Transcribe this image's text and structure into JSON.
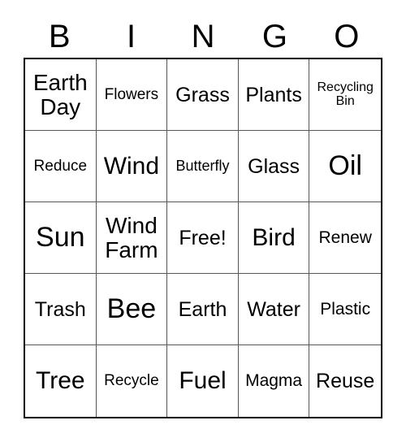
{
  "card": {
    "title": "Bingo Card",
    "header_letters": [
      "B",
      "I",
      "N",
      "G",
      "O"
    ],
    "columns": 5,
    "rows": 5,
    "free_space_label": "Free!",
    "colors": {
      "background": "#ffffff",
      "text": "#000000",
      "outer_border": "#000000",
      "grid_line": "#555555"
    },
    "cells": [
      {
        "text": "Earth\nDay",
        "size": "fs-lg"
      },
      {
        "text": "Flowers",
        "size": "fs-xs"
      },
      {
        "text": "Grass",
        "size": "fs-md"
      },
      {
        "text": "Plants",
        "size": "fs-md"
      },
      {
        "text": "Recycling\nBin",
        "size": "fs-tin"
      },
      {
        "text": "Reduce",
        "size": "fs-xs"
      },
      {
        "text": "Wind",
        "size": "fs-xl"
      },
      {
        "text": "Butterfly",
        "size": "fs-xxs"
      },
      {
        "text": "Glass",
        "size": "fs-md"
      },
      {
        "text": "Oil",
        "size": "fs-xxl"
      },
      {
        "text": "Sun",
        "size": "fs-xxl"
      },
      {
        "text": "Wind\nFarm",
        "size": "fs-lg"
      },
      {
        "text": "Free!",
        "size": "fs-md"
      },
      {
        "text": "Bird",
        "size": "fs-xl"
      },
      {
        "text": "Renew",
        "size": "fs-sm"
      },
      {
        "text": "Trash",
        "size": "fs-md"
      },
      {
        "text": "Bee",
        "size": "fs-xxl"
      },
      {
        "text": "Earth",
        "size": "fs-md"
      },
      {
        "text": "Water",
        "size": "fs-md"
      },
      {
        "text": "Plastic",
        "size": "fs-sm"
      },
      {
        "text": "Tree",
        "size": "fs-xl"
      },
      {
        "text": "Recycle",
        "size": "fs-xs"
      },
      {
        "text": "Fuel",
        "size": "fs-xl"
      },
      {
        "text": "Magma",
        "size": "fs-sm"
      },
      {
        "text": "Reuse",
        "size": "fs-md"
      }
    ]
  }
}
